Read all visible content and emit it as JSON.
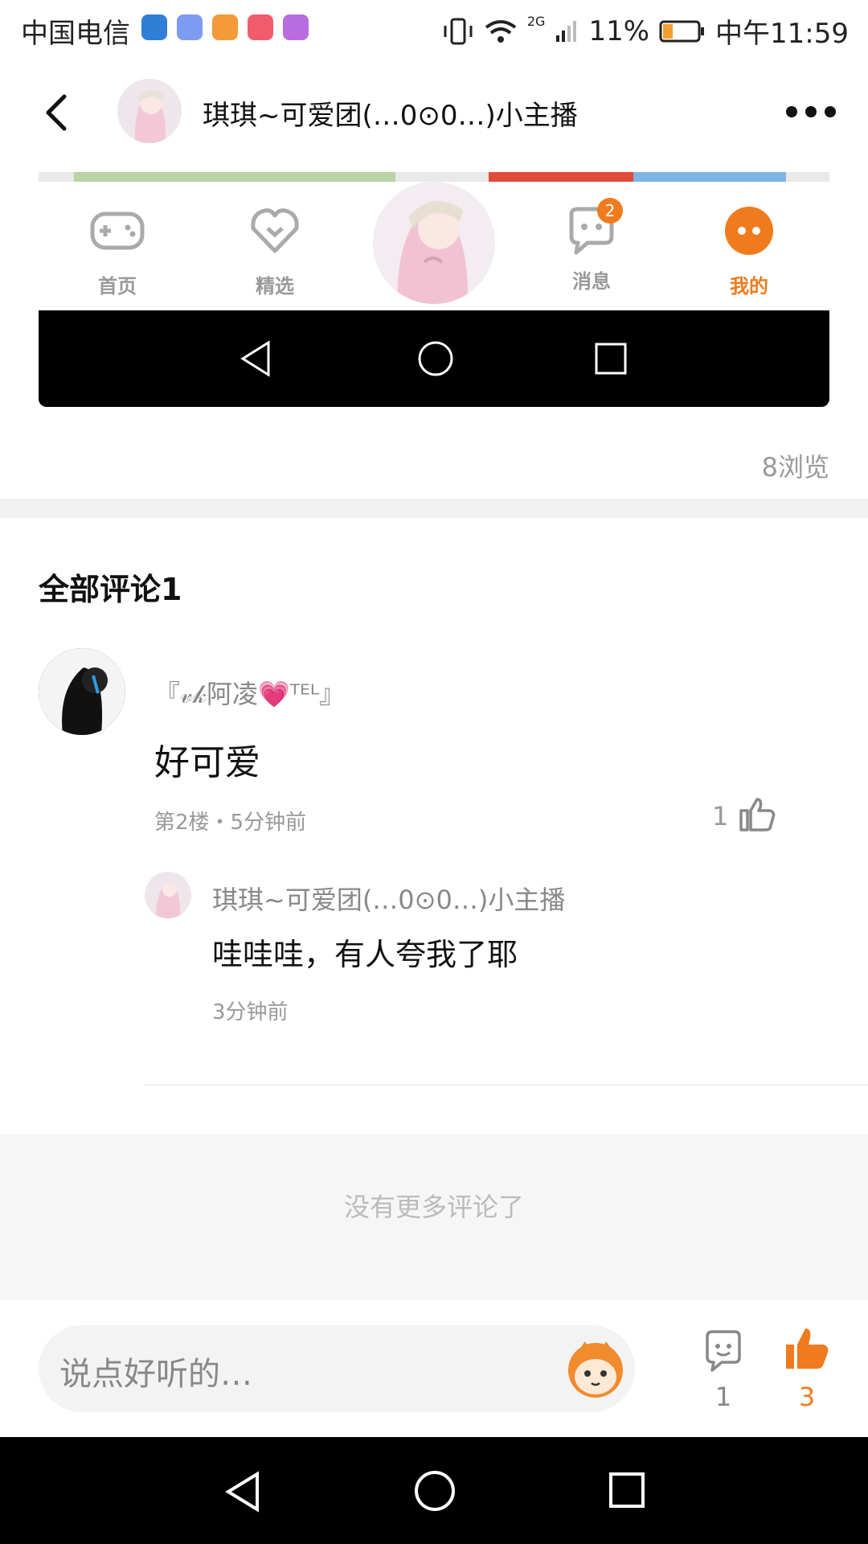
{
  "status_bar": {
    "carrier": "中国电信",
    "signal_label": "2G",
    "battery": "11%",
    "time": "中午11:59"
  },
  "header": {
    "title": "琪琪~可爱团(…0⊙0…)小主播"
  },
  "embedded": {
    "nav": {
      "home": "首页",
      "picks": "精选",
      "messages": "消息",
      "messages_badge": "2",
      "mine": "我的"
    }
  },
  "post": {
    "views": "8浏览"
  },
  "comments": {
    "title": "全部评论1",
    "items": [
      {
        "name": "『𝓋𝓀阿凌💗ᵀᴱᴸ』",
        "text": "好可爱",
        "meta": "第2楼・5分钟前",
        "likes": "1",
        "reply": {
          "name": "琪琪~可爱团(…0⊙0…)小主播",
          "text": "哇哇哇，有人夸我了耶",
          "meta": "3分钟前"
        }
      }
    ],
    "no_more": "没有更多评论了"
  },
  "bottom_bar": {
    "placeholder": "说点好听的…",
    "comment_count": "1",
    "like_count": "3",
    "accent": "#f07b1e"
  }
}
